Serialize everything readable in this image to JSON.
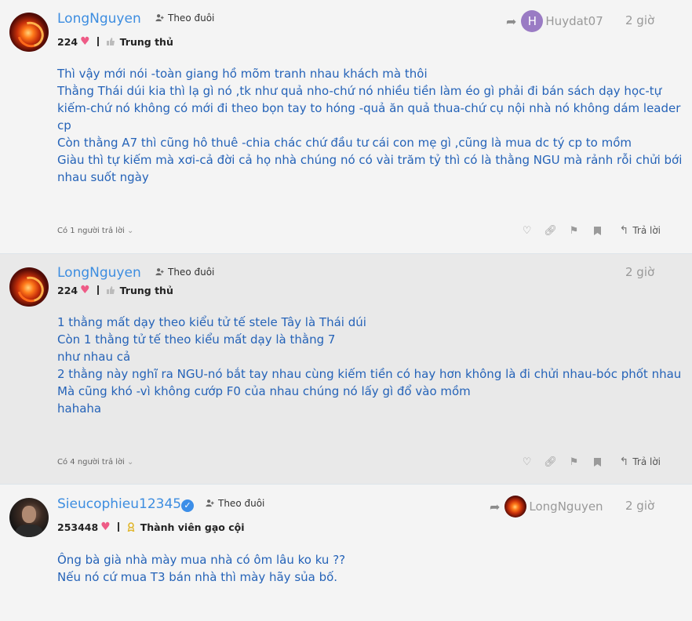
{
  "posts": [
    {
      "username": "LongNguyen",
      "follow_label": "Theo đuôi",
      "score": "224",
      "rank": "Trung thủ",
      "reply_to": "Huydat07",
      "reply_to_initial": "H",
      "time": "2 giờ",
      "lines": [
        "Thì vậy mới nói -toàn giang hồ mõm tranh nhau khách mà thôi",
        "Thằng Thái dúi kia thì lạ gì nó ,tk như quả nho-chứ nó nhiều tiền làm éo gì phải đi bán sách dạy học-tự",
        "kiếm-chứ nó không có mới đi theo bọn tay to hóng -quả ăn quả thua-chứ cụ nội nhà nó không dám leader",
        "cp",
        "Còn thằng A7 thì cũng hô thuê -chia chác chứ đầu tư cái con mẹ gì ,cũng là mua dc tý cp to mồm",
        "Giàu thì tự kiếm mà xơi-cả đời cả họ nhà chúng nó có vài trăm tỷ thì có là thằng NGU mà rảnh rỗi chửi bới",
        "nhau suốt ngày"
      ],
      "replies_label": "Có 1 người trả lời",
      "reply_label": "Trả lời"
    },
    {
      "username": "LongNguyen",
      "follow_label": "Theo đuôi",
      "score": "224",
      "rank": "Trung thủ",
      "time": "2 giờ",
      "lines": [
        "1 thằng mất dạy theo kiểu tử tế stele Tây là Thái dúi",
        "Còn 1 thằng tử tế theo kiểu mất dạy là thằng 7",
        "như nhau cả",
        "2 thằng này nghĩ ra NGU-nó bắt tay nhau cùng kiếm tiền có hay hơn không là đi chửi nhau-bóc phốt nhau",
        "Mà cũng khó -vì không cướp F0 của nhau chúng nó lấy gì đổ vào mồm",
        "hahaha"
      ],
      "replies_label": "Có 4 người trả lời",
      "reply_label": "Trả lời"
    },
    {
      "username": "Sieucophieu12345",
      "follow_label": "Theo đuôi",
      "score": "253448",
      "rank": "Thành viên gạo cội",
      "reply_to": "LongNguyen",
      "time": "2 giờ",
      "lines": [
        "Ông bà già nhà mày mua nhà có ôm lâu ko ku ??",
        "Nếu nó cứ mua T3 bán nhà thì mày hãy sủa bố."
      ]
    }
  ],
  "colors": {
    "username": "#3d8de0",
    "content": "#2563b8",
    "heart": "#ee5b86",
    "rank_gold": "#e0b52a"
  }
}
